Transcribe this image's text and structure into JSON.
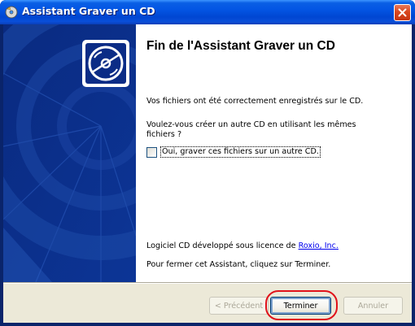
{
  "window": {
    "title": "Assistant Graver un CD"
  },
  "content": {
    "heading": "Fin de l'Assistant Graver un CD",
    "saved_message": "Vos fichiers ont été correctement enregistrés sur le CD.",
    "question": "Voulez-vous créer un autre CD en utilisant les mêmes fichiers ?",
    "checkbox_label": "Oui, graver ces fichiers sur un autre CD.",
    "checkbox_checked": false,
    "license_prefix": "Logiciel CD développé sous licence de ",
    "license_link": "Roxio, Inc.",
    "close_hint": "Pour fermer cet Assistant, cliquez sur Terminer."
  },
  "buttons": {
    "previous": "< Précédent",
    "finish": "Terminer",
    "cancel": "Annuler"
  },
  "icons": {
    "title_icon": "wizard-cd-icon",
    "close": "close-icon",
    "hero": "cd-disc-icon"
  },
  "colors": {
    "titlebar": "#0355e3",
    "left_panel": "#0b2c86",
    "close_button": "#d9471f",
    "annotation": "#e0121a"
  }
}
